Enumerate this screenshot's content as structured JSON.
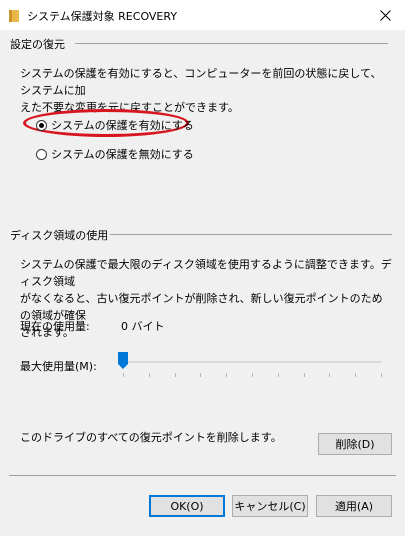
{
  "window": {
    "title": "システム保護対象 RECOVERY"
  },
  "restore_settings": {
    "legend": "設定の復元",
    "description_line1": "システムの保護を有効にすると、コンピューターを前回の状態に戻して、システムに加",
    "description_line2": "えた不要な変更を元に戻すことができます。",
    "options": [
      {
        "label": "システムの保護を有効にする",
        "checked": true
      },
      {
        "label": "システムの保護を無効にする",
        "checked": false
      }
    ]
  },
  "disk_usage": {
    "legend": "ディスク領域の使用量",
    "description_line1": "システムの保護で最大限のディスク領域を使用するように調整できます。ディスク領域",
    "description_line2": "がなくなると、古い復元ポイントが削除され、新しい復元ポイントのための領域が確保",
    "description_line3": "されます。",
    "current_usage_label": "現在の使用量:",
    "current_usage_value": "0 バイト",
    "max_usage_label": "最大使用量(M):",
    "max_usage_value": 0,
    "delete_text": "このドライブのすべての復元ポイントを削除します。",
    "delete_button": "削除(D)"
  },
  "buttons": {
    "ok": "OK(O)",
    "cancel": "キャンセル(C)",
    "apply": "適用(A)"
  },
  "colors": {
    "highlight": "#d7151f",
    "accent": "#0078d7",
    "folder": "#e8b84a"
  }
}
